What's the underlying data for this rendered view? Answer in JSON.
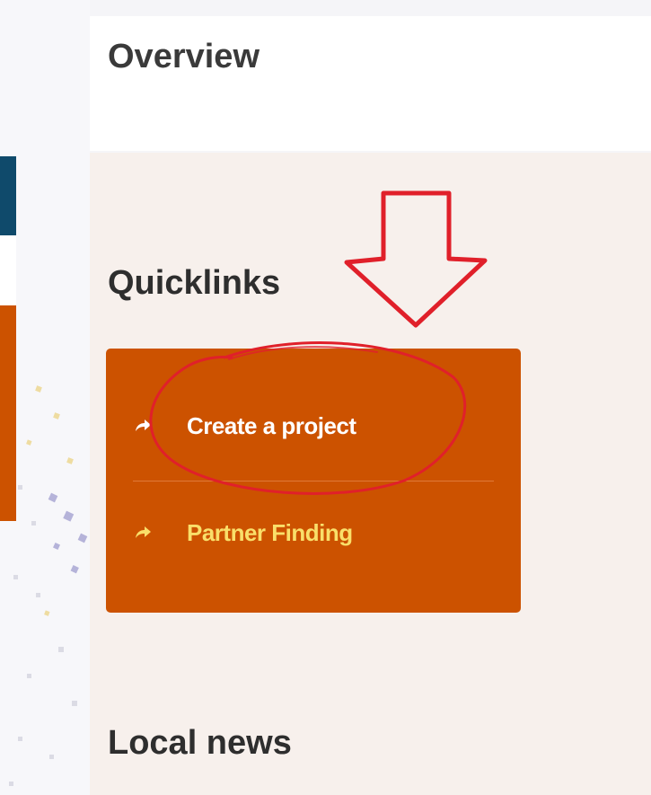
{
  "overview": {
    "title": "Overview"
  },
  "quicklinks": {
    "title": "Quicklinks",
    "items": [
      {
        "label": "Create a project",
        "icon": "share-arrow-icon",
        "color": "#ffffff"
      },
      {
        "label": "Partner Finding",
        "icon": "share-arrow-icon",
        "color": "#f9df6a"
      }
    ],
    "background": "#cc5200"
  },
  "local_news": {
    "title": "Local news"
  },
  "colors": {
    "accent_orange": "#cc5200",
    "brand_blue": "#0f4a6b",
    "panel_bg": "#f7f0ec",
    "annotation_red": "#e0202a"
  }
}
